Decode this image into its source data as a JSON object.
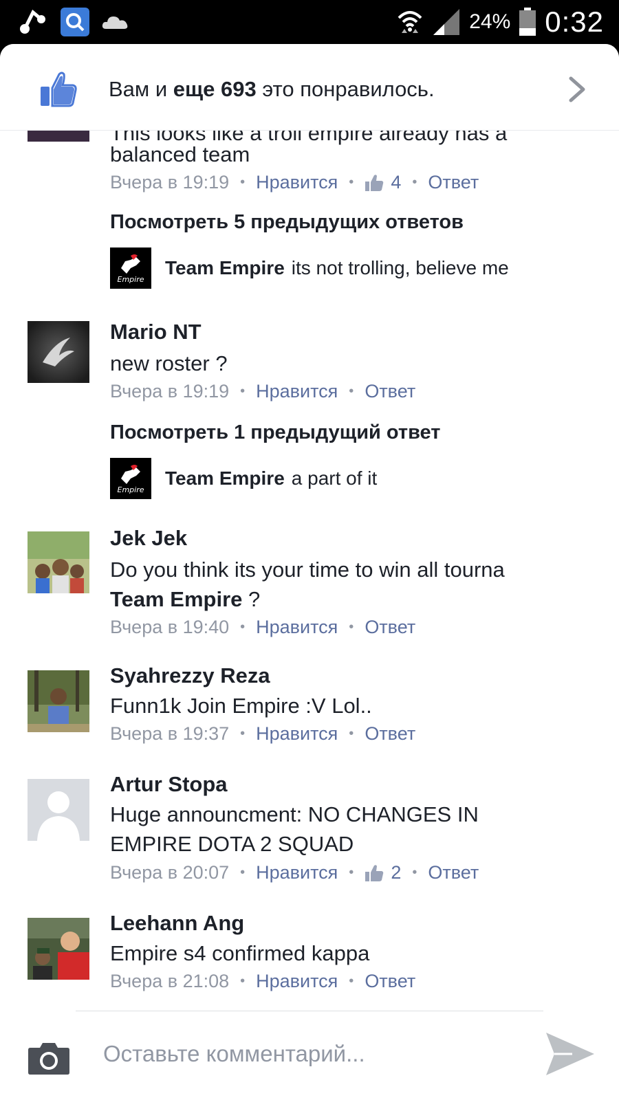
{
  "status_bar": {
    "battery": "24%",
    "time": "0:32",
    "icons": [
      "music-app-icon",
      "search-app-icon",
      "cloud-icon",
      "wifi-icon",
      "signal-icon",
      "battery-icon"
    ]
  },
  "likes": {
    "prefix": "Вам и ",
    "bold": "еще 693",
    "suffix": " это понравилось."
  },
  "comments": [
    {
      "author": "",
      "text_partial_top": "This looks like a troll empire already has a",
      "text": "balanced team",
      "time": "Вчера в 19:19",
      "like_label": "Нравится",
      "like_count": "4",
      "reply_label": "Ответ",
      "view_previous": "Посмотреть 5 предыдущих ответов",
      "reply": {
        "author": "Team Empire",
        "text": "its not trolling, believe me"
      }
    },
    {
      "author": "Mario NT",
      "text": "new roster ?",
      "time": "Вчера в 19:19",
      "like_label": "Нравится",
      "reply_label": "Ответ",
      "view_previous": "Посмотреть 1 предыдущий ответ",
      "reply": {
        "author": "Team Empire",
        "text": "a part of it"
      }
    },
    {
      "author": "Jek Jek",
      "text": "Do you think its your time to win all tourna",
      "mention": "Team Empire",
      "text_after_mention": " ?",
      "time": "Вчера в 19:40",
      "like_label": "Нравится",
      "reply_label": "Ответ"
    },
    {
      "author": "Syahrezzy Reza",
      "text": "Funn1k Join Empire :V Lol..",
      "time": "Вчера в 19:37",
      "like_label": "Нравится",
      "reply_label": "Ответ"
    },
    {
      "author": "Artur Stopa",
      "text_line1": "Huge announcment: NO CHANGES IN",
      "text_line2": "EMPIRE DOTA 2 SQUAD",
      "time": "Вчера в 20:07",
      "like_label": "Нравится",
      "like_count": "2",
      "reply_label": "Ответ"
    },
    {
      "author": "Leehann Ang",
      "text": "Empire s4 confirmed kappa",
      "time": "Вчера в 21:08",
      "like_label": "Нравится",
      "reply_label": "Ответ"
    }
  ],
  "composer": {
    "placeholder": "Оставьте комментарий..."
  },
  "colors": {
    "link": "#5b6e9e",
    "meta": "#9197a3",
    "like_blue": "#4a78d6"
  }
}
